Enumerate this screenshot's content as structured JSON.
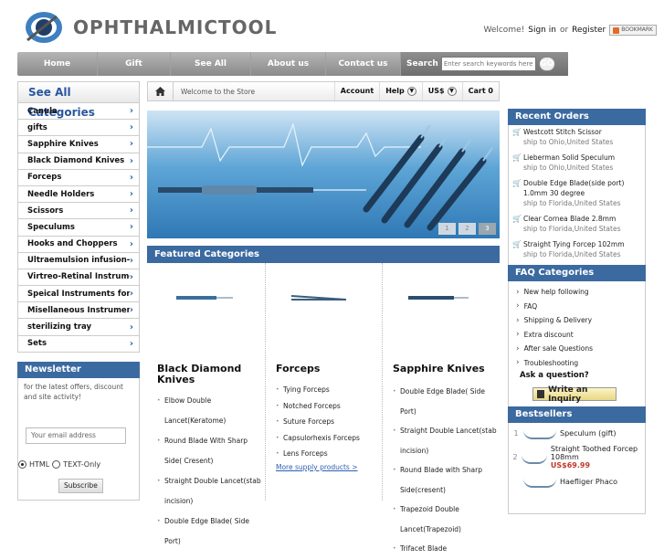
{
  "header": {
    "brand": "OPHTHALMICTOOL",
    "welcome": "Welcome!",
    "sign_in": "Sign in",
    "or": "or",
    "register": "Register",
    "bookmark": "BOOKMARK"
  },
  "nav": {
    "items": [
      "Home",
      "Gift",
      "See All",
      "About us",
      "Contact us"
    ],
    "search_label": "Search",
    "search_placeholder": "Enter search keywords here",
    "go": "GO"
  },
  "categories": {
    "title": "See All Categories",
    "items": [
      "Canula",
      "gifts",
      "Sapphire Knives",
      "Black Diamond Knives",
      "Forceps",
      "Needle Holders",
      "Scissors",
      "Speculums",
      "Hooks and Choppers",
      "Ultraemulsion infusion-suction",
      "Virtreo-Retinal Instruments",
      "Speical Instruments for Lasik",
      "Misellaneous Instruments",
      "sterilizing tray",
      "Sets"
    ]
  },
  "newsletter": {
    "title": "Newsletter",
    "text": "for the latest offers, discount and site activity!",
    "email_placeholder": "Your email address",
    "html_label": "HTML",
    "text_label": "TEXT-Only",
    "subscribe": "Subscribe"
  },
  "breadcrumb": {
    "welcome": "Welcome to the Store",
    "account": "Account",
    "help": "Help",
    "currency": "US$",
    "cart": "Cart 0"
  },
  "banner": {
    "pages": [
      "1",
      "2",
      "3"
    ],
    "active_page": 3
  },
  "featured": {
    "title": "Featured Categories",
    "columns": [
      {
        "name": "Black Diamond Knives",
        "items": [
          "Elbow Double Lancet(Keratome)",
          "Round Blade With Sharp Side( Cresent)",
          "Straight Double Lancet(stab incision)",
          "Double Edge Blade( Side Port)"
        ]
      },
      {
        "name": "Forceps",
        "items": [
          "Tying Forceps",
          "Notched Forceps",
          "Suture Forceps",
          "Capsulorhexis Forceps",
          "Lens Forceps"
        ],
        "more": "More supply products >"
      },
      {
        "name": "Sapphire Knives",
        "items": [
          "Double Edge Blade( Side Port)",
          "Straight Double Lancet(stab incision)",
          "Round Blade with Sharp Side(cresent)",
          "Trapezoid Double Lancet(Trapezoid)",
          "Trifacet Blade"
        ]
      }
    ]
  },
  "recent_orders": {
    "title": "Recent Orders",
    "items": [
      {
        "name": "Westcott Stitch Scissor",
        "ship": "ship to Ohio,United States"
      },
      {
        "name": "Lieberman Solid Speculum",
        "ship": "ship to Ohio,United States"
      },
      {
        "name": "Double Edge Blade(side port) 1.0mm 30 degree",
        "ship": "ship to Florida,United States"
      },
      {
        "name": "Clear Cornea Blade 2.8mm",
        "ship": "ship to Florida,United States"
      },
      {
        "name": "Straight Tying Forcep 102mm",
        "ship": "ship to Florida,United States"
      }
    ]
  },
  "faq": {
    "title": "FAQ Categories",
    "items": [
      "New help following",
      "FAQ",
      "Shipping & Delivery",
      "Extra discount",
      "After sale Questions",
      "Troubleshooting"
    ],
    "ask": "Ask a question?",
    "inquiry": "Write an Inquiry"
  },
  "bestsellers": {
    "title": "Bestsellers",
    "items": [
      {
        "rank": "1",
        "name": "Speculum (gift)",
        "price": ""
      },
      {
        "rank": "2",
        "name": "Straight Toothed Forcep 108mm",
        "price": "US$69.99"
      },
      {
        "rank": "",
        "name": "Haefliger Phaco",
        "price": ""
      }
    ]
  },
  "colors": {
    "accent": "#3b6aa0",
    "link": "#2a5fb0",
    "price": "#c0392b"
  }
}
